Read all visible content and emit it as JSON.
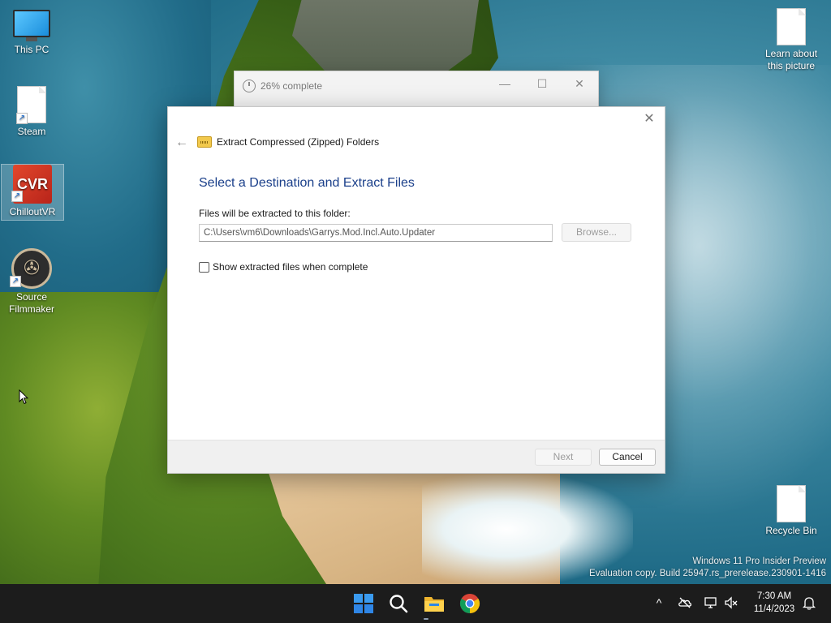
{
  "desktop": {
    "icons": [
      {
        "label": "This PC"
      },
      {
        "label": "Steam"
      },
      {
        "label": "ChilloutVR"
      },
      {
        "label": "Source Filmmaker"
      },
      {
        "label": "Learn about this picture"
      },
      {
        "label": "Recycle Bin"
      }
    ],
    "watermark": {
      "line1": "Windows 11 Pro Insider Preview",
      "line2": "Evaluation copy. Build 25947.rs_prerelease.230901-1416"
    }
  },
  "progress_window": {
    "title": "26% complete",
    "progress_percent": 26
  },
  "dialog": {
    "wizard_title": "Extract Compressed (Zipped) Folders",
    "heading": "Select a Destination and Extract Files",
    "destination_label": "Files will be extracted to this folder:",
    "destination_path": "C:\\Users\\vm6\\Downloads\\Garrys.Mod.Incl.Auto.Updater",
    "browse_label": "Browse...",
    "show_files_label": "Show extracted files when complete",
    "show_files_checked": false,
    "next_label": "Next",
    "cancel_label": "Cancel"
  },
  "taskbar": {
    "apps": [
      "start-icon",
      "search-icon",
      "file-explorer-icon",
      "chrome-icon"
    ],
    "time": "7:30 AM",
    "date": "11/4/2023"
  },
  "colors": {
    "heading": "#1a3f8a",
    "taskbar": "#1c1c1c",
    "start_blue": "#2f86e6"
  }
}
